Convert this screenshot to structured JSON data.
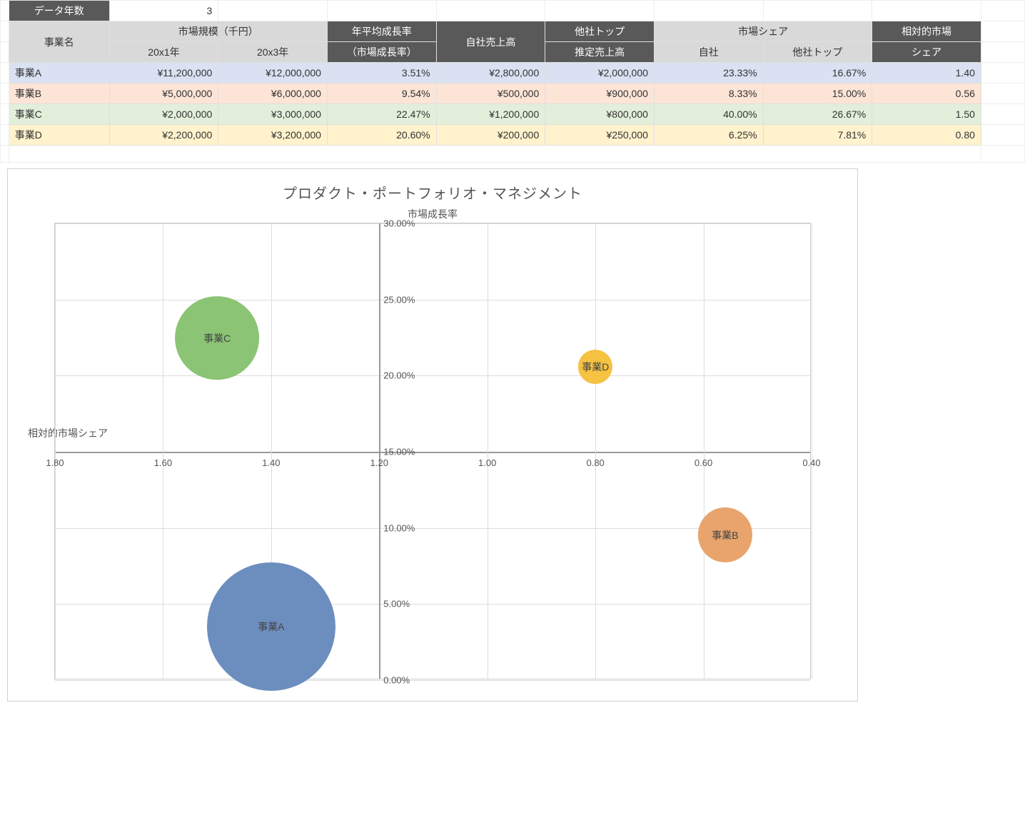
{
  "header_row": {
    "data_years_label": "データ年数",
    "data_years_value": "3"
  },
  "table": {
    "col_business": "事業名",
    "col_market_size": "市場規模（千円）",
    "col_year1": "20x1年",
    "col_year3": "20x3年",
    "col_growth1": "年平均成長率",
    "col_growth2": "（市場成長率）",
    "col_own_sales": "自社売上高",
    "col_top_other1": "他社トップ",
    "col_top_other2": "推定売上高",
    "col_share": "市場シェア",
    "col_share_own": "自社",
    "col_share_other": "他社トップ",
    "col_rel_share1": "相対的市場",
    "col_rel_share2": "シェア",
    "rows": [
      {
        "name": "事業A",
        "y1": "¥11,200,000",
        "y3": "¥12,000,000",
        "g": "3.51%",
        "own": "¥2,800,000",
        "top": "¥2,000,000",
        "s_own": "23.33%",
        "s_top": "16.67%",
        "rel": "1.40"
      },
      {
        "name": "事業B",
        "y1": "¥5,000,000",
        "y3": "¥6,000,000",
        "g": "9.54%",
        "own": "¥500,000",
        "top": "¥900,000",
        "s_own": "8.33%",
        "s_top": "15.00%",
        "rel": "0.56"
      },
      {
        "name": "事業C",
        "y1": "¥2,000,000",
        "y3": "¥3,000,000",
        "g": "22.47%",
        "own": "¥1,200,000",
        "top": "¥800,000",
        "s_own": "40.00%",
        "s_top": "26.67%",
        "rel": "1.50"
      },
      {
        "name": "事業D",
        "y1": "¥2,200,000",
        "y3": "¥3,200,000",
        "g": "20.60%",
        "own": "¥200,000",
        "top": "¥250,000",
        "s_own": "6.25%",
        "s_top": "7.81%",
        "rel": "0.80"
      }
    ]
  },
  "chart": {
    "title": "プロダクト・ポートフォリオ・マネジメント",
    "y_axis_label": "市場成長率",
    "x_axis_label": "相対的市場シェア",
    "y_ticks": [
      "30.00%",
      "25.00%",
      "20.00%",
      "15.00%",
      "10.00%",
      "5.00%",
      "0.00%"
    ],
    "x_ticks": [
      "1.80",
      "1.60",
      "1.40",
      "1.20",
      "1.00",
      "0.80",
      "0.60",
      "0.40"
    ]
  },
  "chart_data": {
    "type": "scatter",
    "title": "プロダクト・ポートフォリオ・マネジメント",
    "xlabel": "相対的市場シェア",
    "ylabel": "市場成長率",
    "xlim": [
      1.8,
      0.4
    ],
    "ylim": [
      0.0,
      0.3
    ],
    "x_reversed": true,
    "cross_x": 1.2,
    "cross_y": 0.15,
    "series": [
      {
        "name": "事業A",
        "x": 1.4,
        "y": 0.0351,
        "size": 2800000,
        "color": "#6c8ebf"
      },
      {
        "name": "事業B",
        "x": 0.56,
        "y": 0.0954,
        "size": 500000,
        "color": "#e8a46c"
      },
      {
        "name": "事業C",
        "x": 1.5,
        "y": 0.2247,
        "size": 1200000,
        "color": "#8bc474"
      },
      {
        "name": "事業D",
        "x": 0.8,
        "y": 0.206,
        "size": 200000,
        "color": "#f5c242"
      }
    ]
  }
}
